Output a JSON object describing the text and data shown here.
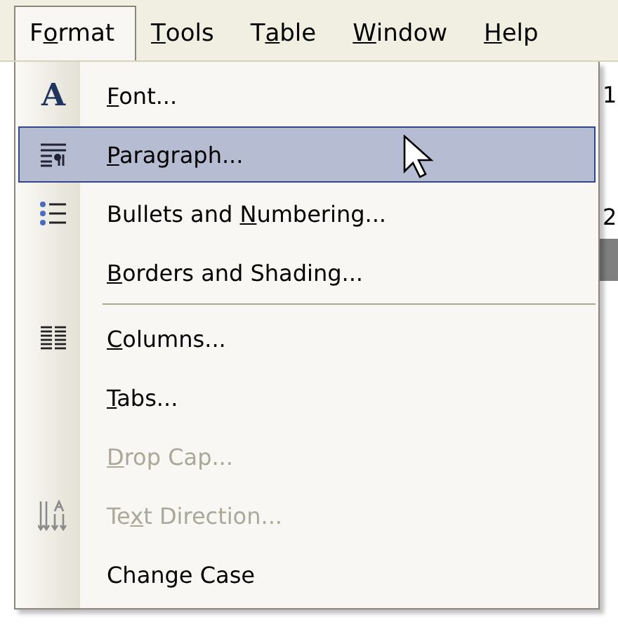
{
  "menubar": [
    {
      "pre": "F",
      "key": "o",
      "post": "rmat",
      "selected": true
    },
    {
      "key": "T",
      "post": "ools",
      "selected": false
    },
    {
      "pre": "T",
      "key": "a",
      "post": "ble",
      "selected": false
    },
    {
      "key": "W",
      "post": "indow",
      "selected": false
    },
    {
      "key": "H",
      "post": "elp",
      "selected": false
    }
  ],
  "menu": [
    {
      "kind": "font",
      "icon_char": "A",
      "key": "F",
      "post": "ont...",
      "selected": false,
      "disabled": false
    },
    {
      "kind": "paragraph",
      "key": "P",
      "post": "aragraph...",
      "selected": true,
      "disabled": false
    },
    {
      "kind": "bullets",
      "pre": "Bullets and ",
      "key": "N",
      "post": "umbering...",
      "selected": false,
      "disabled": false
    },
    {
      "kind": "plain",
      "key": "B",
      "post": "orders and Shading...",
      "selected": false,
      "disabled": false
    },
    {
      "kind": "separator"
    },
    {
      "kind": "columns",
      "key": "C",
      "post": "olumns...",
      "selected": false,
      "disabled": false
    },
    {
      "kind": "plain",
      "key": "T",
      "post": "abs...",
      "selected": false,
      "disabled": false
    },
    {
      "kind": "plain",
      "key": "D",
      "post": "rop Cap...",
      "selected": false,
      "disabled": true
    },
    {
      "kind": "text-direction",
      "pre": "Te",
      "key": "x",
      "post": "t Direction...",
      "selected": false,
      "disabled": true
    },
    {
      "kind": "plain",
      "pre": "Change Case",
      "selected": false,
      "disabled": false
    }
  ],
  "background": [
    "1",
    "2"
  ]
}
